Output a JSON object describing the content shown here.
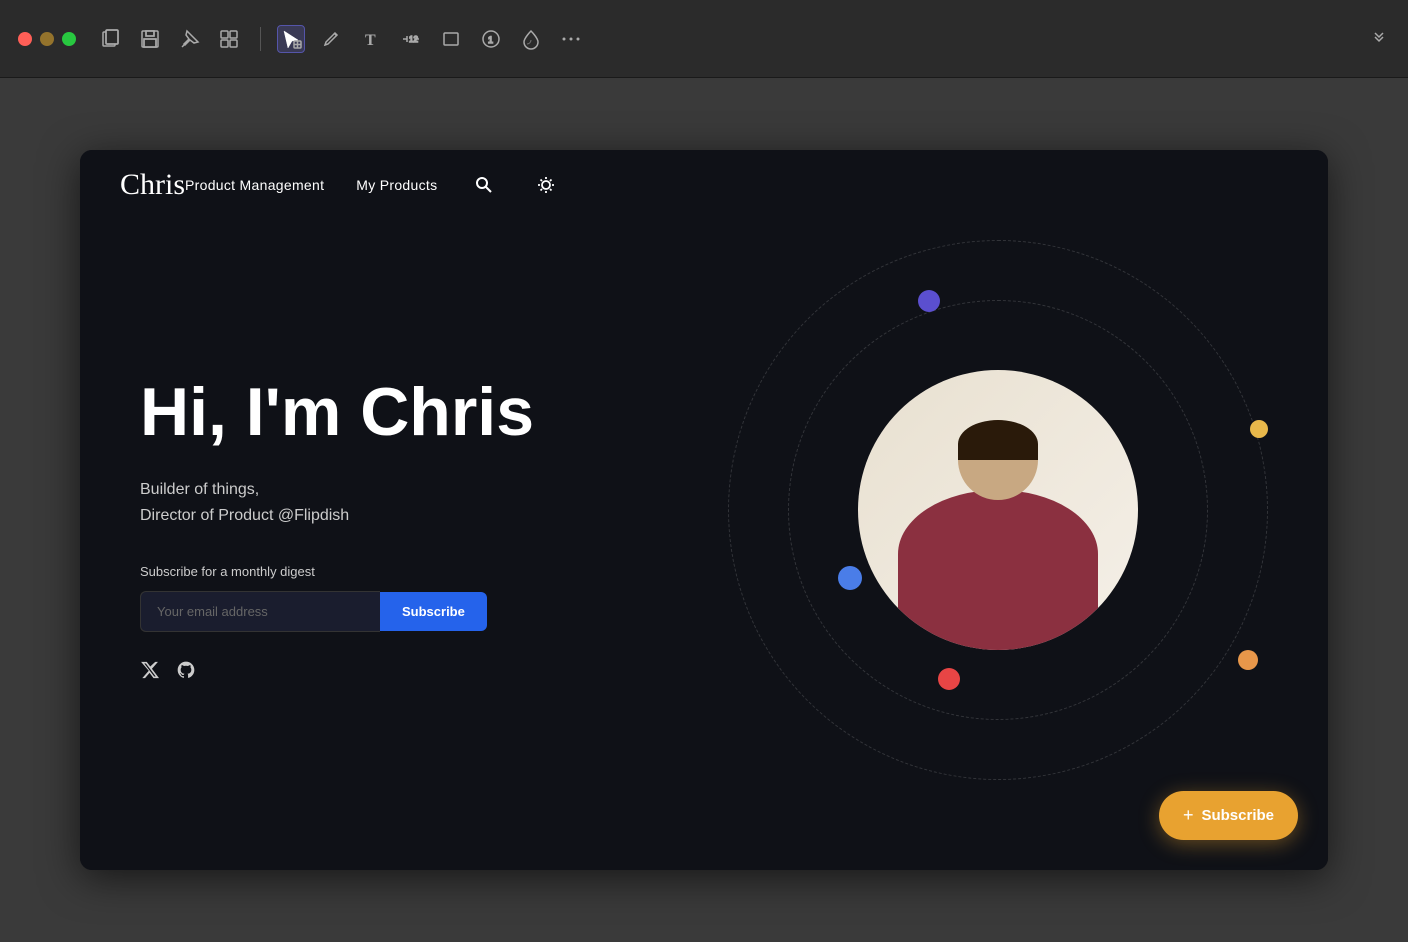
{
  "toolbar": {
    "icons": [
      {
        "name": "copy-pages-icon",
        "symbol": "⧉"
      },
      {
        "name": "save-icon",
        "symbol": "⊟"
      },
      {
        "name": "pin-icon",
        "symbol": "⊕"
      },
      {
        "name": "grid-icon",
        "symbol": "⠿"
      },
      {
        "name": "select-icon",
        "symbol": "↖#",
        "active": true
      },
      {
        "name": "pen-icon",
        "symbol": "↩"
      },
      {
        "name": "text-icon",
        "symbol": "T"
      },
      {
        "name": "measure-icon",
        "symbol": "⊢"
      },
      {
        "name": "rect-icon",
        "symbol": "□"
      },
      {
        "name": "circle-icon",
        "symbol": "①"
      },
      {
        "name": "drop-icon",
        "symbol": "◈"
      },
      {
        "name": "more-icon",
        "symbol": "···"
      }
    ],
    "chevron": ">>"
  },
  "site": {
    "logo": "Chris",
    "nav": {
      "links": [
        {
          "label": "Product Management",
          "href": "#"
        },
        {
          "label": "My Products",
          "href": "#"
        }
      ],
      "search_icon": "🔍",
      "theme_icon": "☀"
    },
    "hero": {
      "title": "Hi, I'm Chris",
      "subtitle_line1": "Builder of things,",
      "subtitle_line2": "Director of Product @Flipdish",
      "subscribe_label": "Subscribe for a monthly digest",
      "email_placeholder": "Your email address",
      "subscribe_button": "Subscribe",
      "social_twitter": "𝕏",
      "social_github": "⊙"
    },
    "floating_subscribe": {
      "label": "Subscribe",
      "plus": "+"
    }
  },
  "colors": {
    "background": "#0f1117",
    "accent_blue": "#2563eb",
    "accent_orange": "#e8a230",
    "dot_purple": "#5b4fcf",
    "dot_yellow": "#e8b84b",
    "dot_blue": "#4a7de8",
    "dot_red": "#e84545",
    "dot_orange_sm": "#e8974a"
  }
}
